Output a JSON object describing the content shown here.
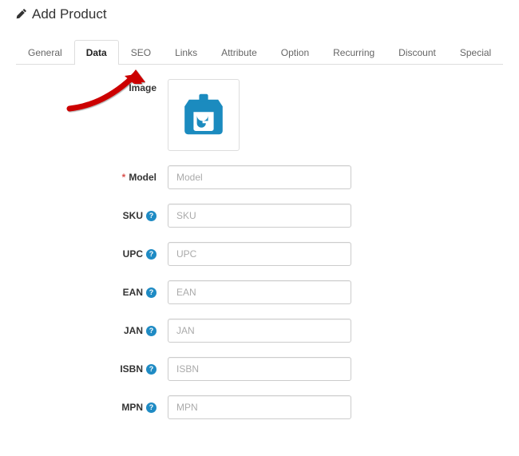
{
  "header": {
    "title": "Add Product"
  },
  "tabs": {
    "items": [
      {
        "label": "General"
      },
      {
        "label": "Data"
      },
      {
        "label": "SEO"
      },
      {
        "label": "Links"
      },
      {
        "label": "Attribute"
      },
      {
        "label": "Option"
      },
      {
        "label": "Recurring"
      },
      {
        "label": "Discount"
      },
      {
        "label": "Special"
      }
    ],
    "active": 1
  },
  "form": {
    "image": {
      "label": "Image"
    },
    "model": {
      "label": "Model",
      "placeholder": "Model",
      "required": true,
      "value": ""
    },
    "sku": {
      "label": "SKU",
      "placeholder": "SKU",
      "help": true,
      "value": ""
    },
    "upc": {
      "label": "UPC",
      "placeholder": "UPC",
      "help": true,
      "value": ""
    },
    "ean": {
      "label": "EAN",
      "placeholder": "EAN",
      "help": true,
      "value": ""
    },
    "jan": {
      "label": "JAN",
      "placeholder": "JAN",
      "help": true,
      "value": ""
    },
    "isbn": {
      "label": "ISBN",
      "placeholder": "ISBN",
      "help": true,
      "value": ""
    },
    "mpn": {
      "label": "MPN",
      "placeholder": "MPN",
      "help": true,
      "value": ""
    }
  },
  "help_glyph": "?"
}
